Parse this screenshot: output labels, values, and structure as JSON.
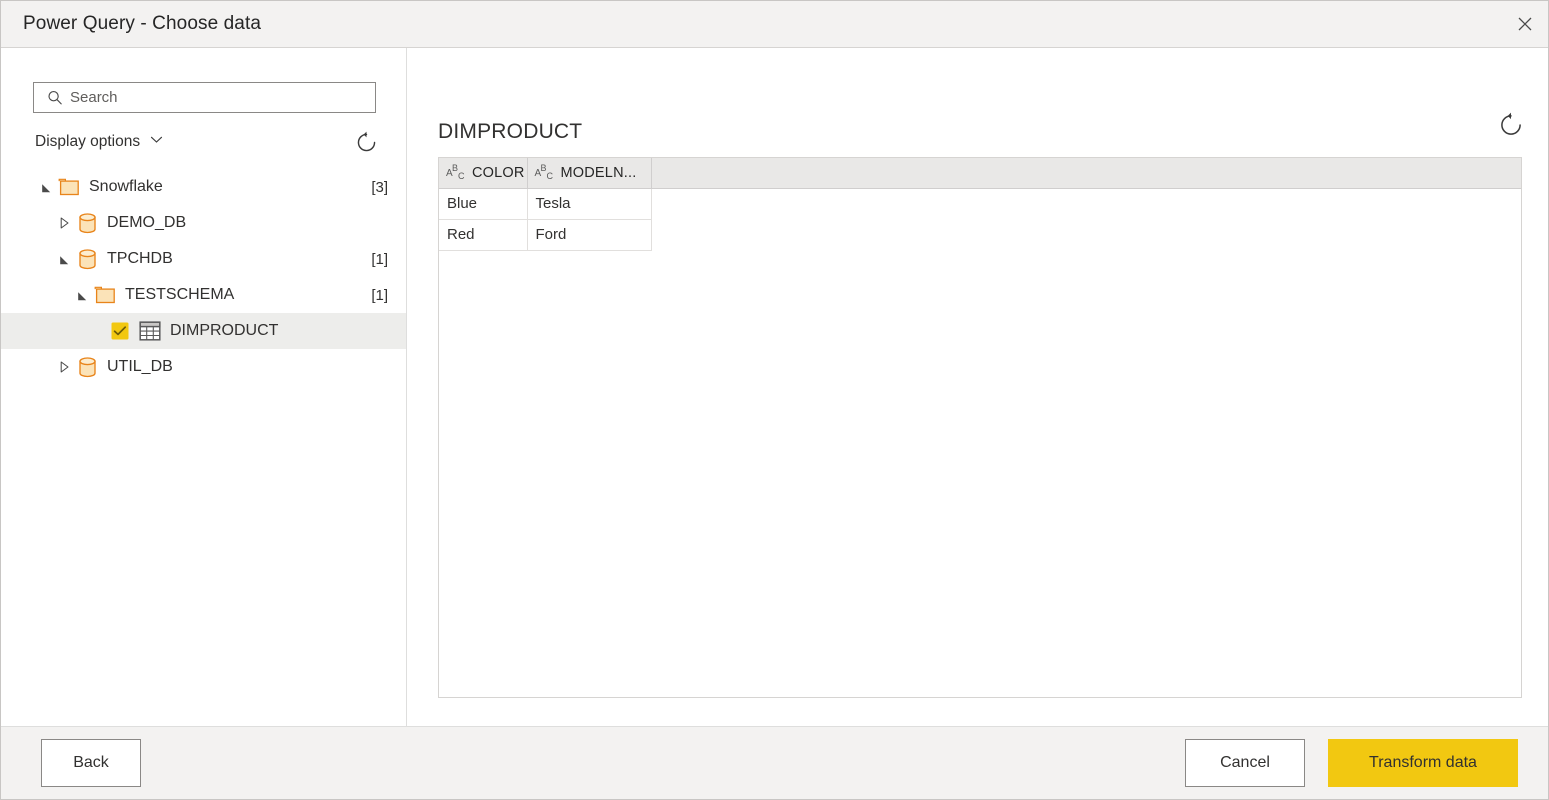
{
  "window": {
    "title": "Power Query - Choose data",
    "close_icon": "close-icon"
  },
  "search": {
    "placeholder": "Search",
    "value": "",
    "icon": "search-icon"
  },
  "display_options": {
    "label": "Display options",
    "chevron_icon": "chevron-down-icon",
    "refresh_icon": "refresh-icon"
  },
  "tree": {
    "items": [
      {
        "label": "Snowflake",
        "count": "[3]",
        "depth": 0,
        "icon": "folder-icon",
        "state": "expanded",
        "checkbox": false,
        "selected": false
      },
      {
        "label": "DEMO_DB",
        "count": "",
        "depth": 1,
        "icon": "database-icon",
        "state": "collapsed",
        "checkbox": false,
        "selected": false
      },
      {
        "label": "TPCHDB",
        "count": "[1]",
        "depth": 1,
        "icon": "database-icon",
        "state": "expanded",
        "checkbox": false,
        "selected": false
      },
      {
        "label": "TESTSCHEMA",
        "count": "[1]",
        "depth": 2,
        "icon": "folder-icon",
        "state": "expanded",
        "checkbox": false,
        "selected": false
      },
      {
        "label": "DIMPRODUCT",
        "count": "",
        "depth": 3,
        "icon": "table-icon",
        "state": "leaf",
        "checkbox": true,
        "selected": true
      },
      {
        "label": "UTIL_DB",
        "count": "",
        "depth": 1,
        "icon": "database-icon",
        "state": "collapsed",
        "checkbox": false,
        "selected": false
      }
    ]
  },
  "preview": {
    "title": "DIMPRODUCT",
    "refresh_icon": "refresh-icon",
    "columns": [
      {
        "name": "COLOR",
        "type_icon": "abc-text-type-icon"
      },
      {
        "name": "MODELN...",
        "type_icon": "abc-text-type-icon"
      }
    ],
    "rows": [
      [
        "Blue",
        "Tesla"
      ],
      [
        "Red",
        "Ford"
      ]
    ]
  },
  "footer": {
    "back_label": "Back",
    "cancel_label": "Cancel",
    "transform_label": "Transform data"
  },
  "colors": {
    "accent_yellow": "#F2C811",
    "folder_border": "#E8841A",
    "folder_fill": "#FBE3B8",
    "titlebar_bg": "#F3F2F1",
    "selection_bg": "#EDEDEB",
    "table_header_bg": "#E9E8E7"
  }
}
